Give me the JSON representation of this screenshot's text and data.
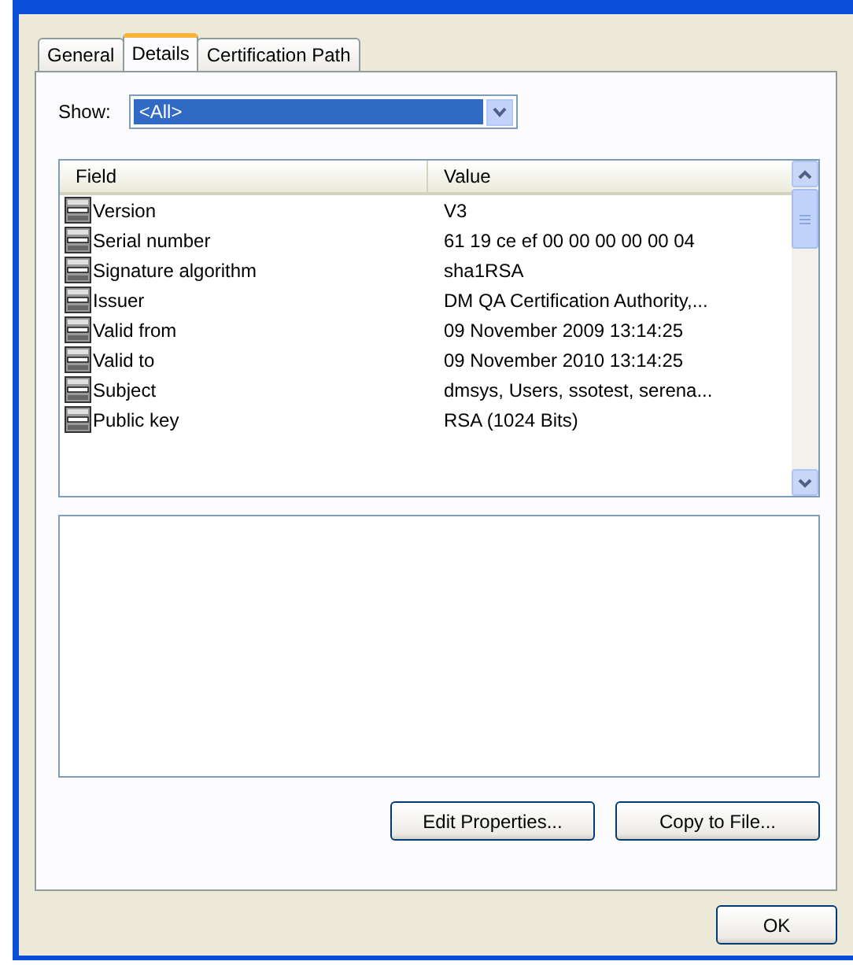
{
  "tabs": [
    {
      "label": "General",
      "selected": false
    },
    {
      "label": "Details",
      "selected": true
    },
    {
      "label": "Certification Path",
      "selected": false
    }
  ],
  "show": {
    "label": "Show:",
    "value": "<All>"
  },
  "list": {
    "columns": [
      "Field",
      "Value"
    ],
    "rows": [
      {
        "field": "Version",
        "value": "V3"
      },
      {
        "field": "Serial number",
        "value": "61 19 ce ef 00 00 00 00 00 04"
      },
      {
        "field": "Signature algorithm",
        "value": "sha1RSA"
      },
      {
        "field": "Issuer",
        "value": "DM QA Certification Authority,..."
      },
      {
        "field": "Valid from",
        "value": "09 November 2009 13:14:25"
      },
      {
        "field": "Valid to",
        "value": "09 November 2010 13:14:25"
      },
      {
        "field": "Subject",
        "value": "dmsys, Users, ssotest, serena..."
      },
      {
        "field": "Public key",
        "value": "RSA (1024 Bits)"
      }
    ]
  },
  "panel_buttons": [
    "Edit Properties...",
    "Copy to File..."
  ],
  "buttons": [
    "OK"
  ]
}
